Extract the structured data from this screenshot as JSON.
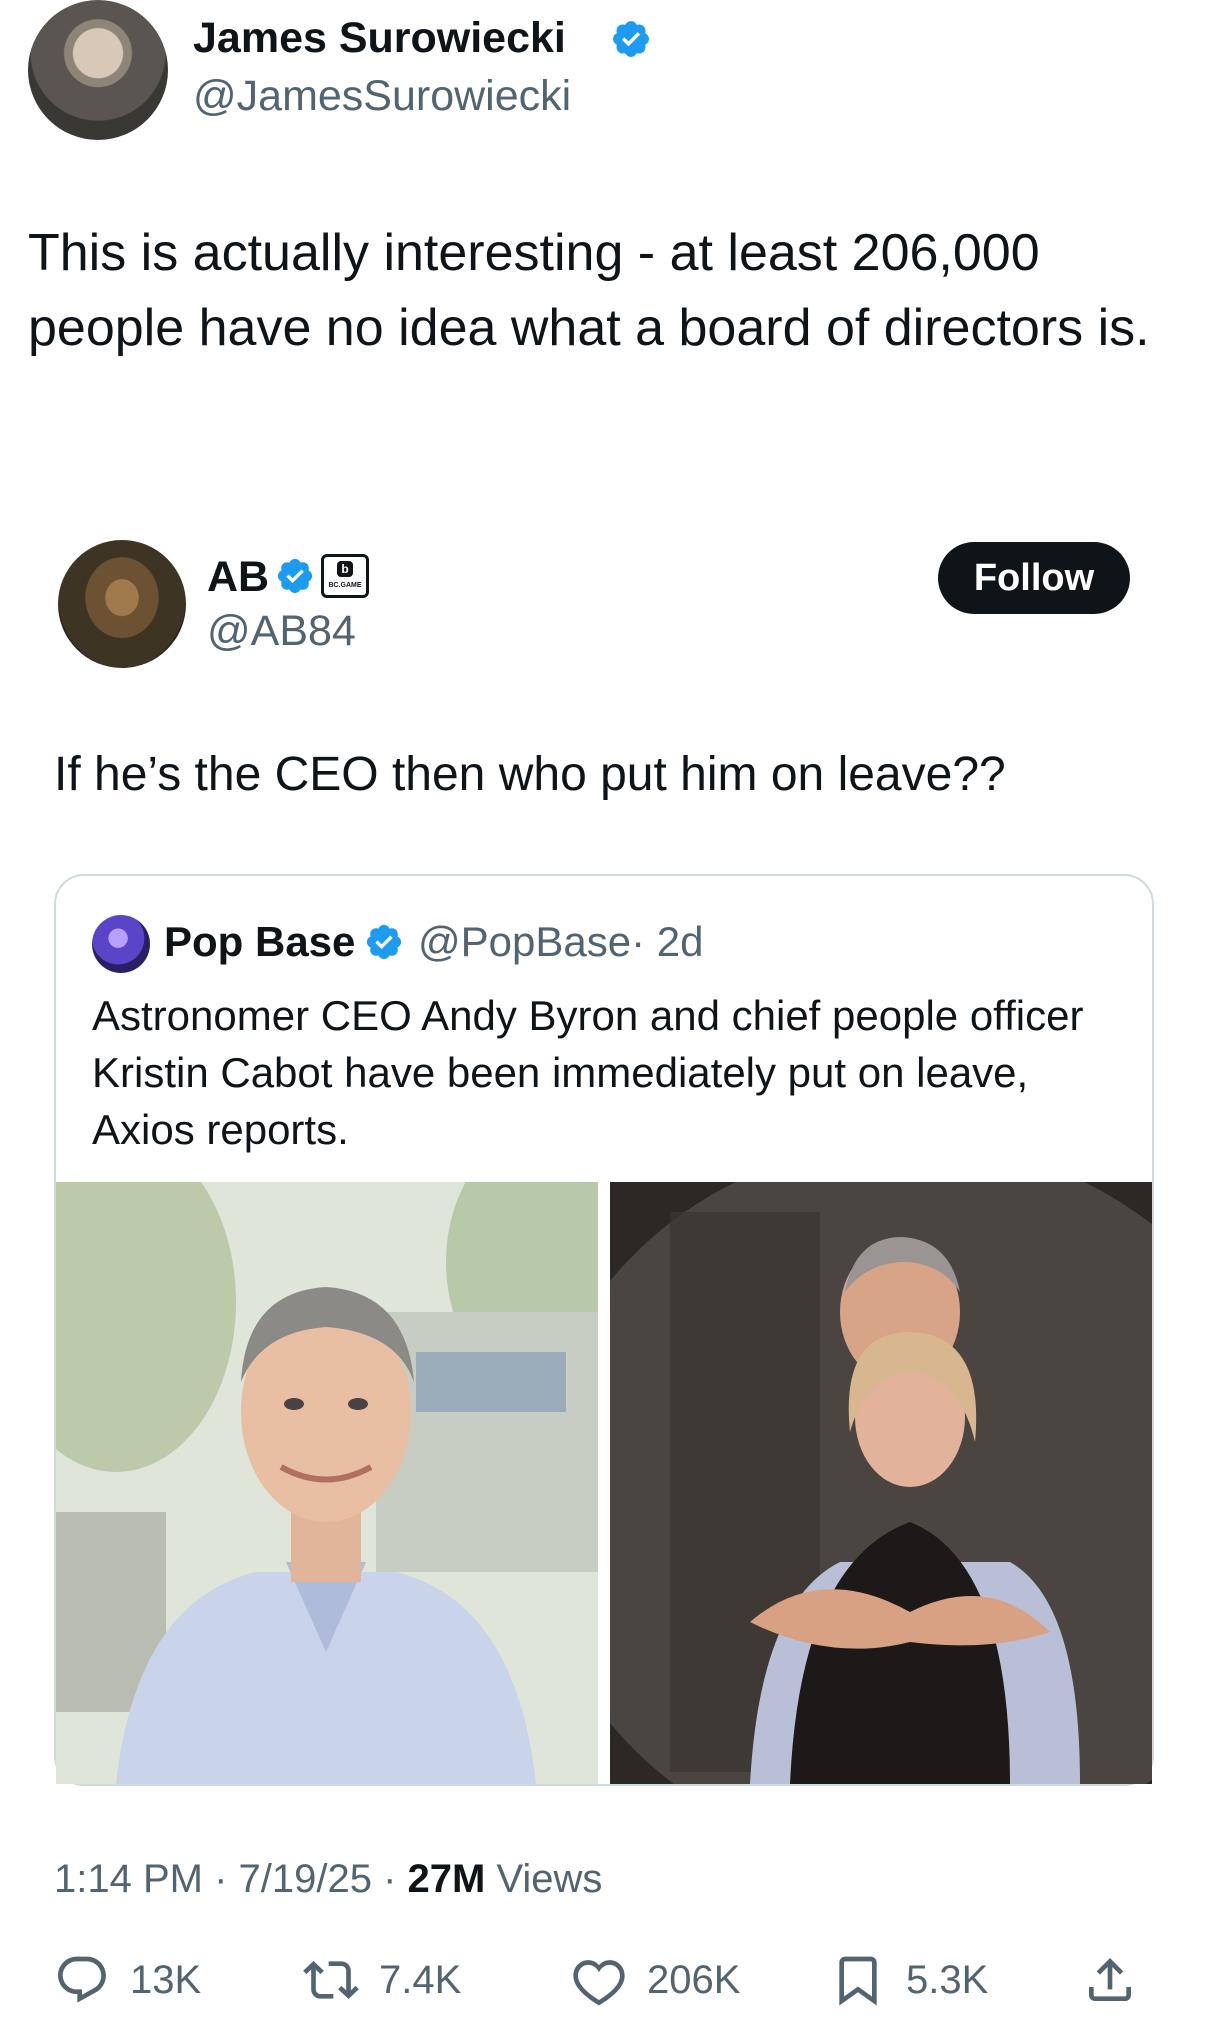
{
  "outer_tweet": {
    "author_name": "James Surowiecki",
    "author_handle": "@JamesSurowiecki",
    "text": "This is actually interesting - at least 206,000 people have no idea what a board of directors is."
  },
  "quoted_tweet": {
    "author_name": "AB",
    "author_handle": "@AB84",
    "badge_label": "BC.GAME",
    "follow_label": "Follow",
    "text": "If he’s the CEO then who put him on leave??"
  },
  "nested_quote": {
    "author_name": "Pop Base",
    "author_handle": "@PopBase",
    "age": "· 2d",
    "text": "Astronomer CEO Andy Byron and chief people officer Kristin Cabot have been immediately put on leave, Axios reports."
  },
  "meta": {
    "time_date": "1:14 PM · 7/19/25 · ",
    "views_count": "27M",
    "views_label": " Views"
  },
  "actions": {
    "reply_count": "13K",
    "repost_count": "7.4K",
    "like_count": "206K",
    "bookmark_count": "5.3K"
  },
  "colors": {
    "verified": "#1d9bf0",
    "secondary_text": "#536471",
    "primary_text": "#0f1419"
  }
}
